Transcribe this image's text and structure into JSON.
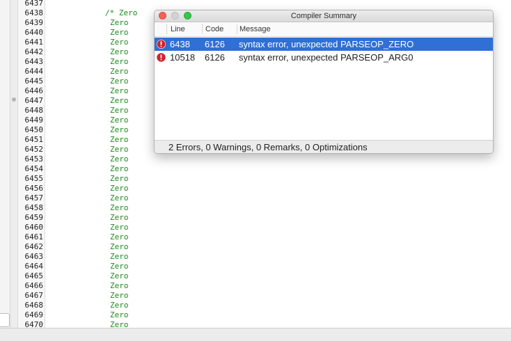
{
  "editor": {
    "lines": [
      {
        "num": "6437",
        "code": ""
      },
      {
        "num": "6438",
        "code": "/* Zero"
      },
      {
        "num": "6439",
        "code": "Zero"
      },
      {
        "num": "6440",
        "code": "Zero"
      },
      {
        "num": "6441",
        "code": "Zero"
      },
      {
        "num": "6442",
        "code": "Zero"
      },
      {
        "num": "6443",
        "code": "Zero"
      },
      {
        "num": "6444",
        "code": "Zero"
      },
      {
        "num": "6445",
        "code": "Zero"
      },
      {
        "num": "6446",
        "code": "Zero"
      },
      {
        "num": "6447",
        "code": "Zero"
      },
      {
        "num": "6448",
        "code": "Zero"
      },
      {
        "num": "6449",
        "code": "Zero"
      },
      {
        "num": "6450",
        "code": "Zero"
      },
      {
        "num": "6451",
        "code": "Zero"
      },
      {
        "num": "6452",
        "code": "Zero"
      },
      {
        "num": "6453",
        "code": "Zero"
      },
      {
        "num": "6454",
        "code": "Zero"
      },
      {
        "num": "6455",
        "code": "Zero"
      },
      {
        "num": "6456",
        "code": "Zero"
      },
      {
        "num": "6457",
        "code": "Zero"
      },
      {
        "num": "6458",
        "code": "Zero"
      },
      {
        "num": "6459",
        "code": "Zero"
      },
      {
        "num": "6460",
        "code": "Zero"
      },
      {
        "num": "6461",
        "code": "Zero"
      },
      {
        "num": "6462",
        "code": "Zero"
      },
      {
        "num": "6463",
        "code": "Zero"
      },
      {
        "num": "6464",
        "code": "Zero"
      },
      {
        "num": "6465",
        "code": "Zero"
      },
      {
        "num": "6466",
        "code": "Zero"
      },
      {
        "num": "6467",
        "code": "Zero"
      },
      {
        "num": "6468",
        "code": "Zero"
      },
      {
        "num": "6469",
        "code": "Zero"
      },
      {
        "num": "6470",
        "code": "Zero"
      }
    ]
  },
  "dialog": {
    "title": "Compiler Summary",
    "columns": {
      "line": "Line",
      "code": "Code",
      "message": "Message"
    },
    "rows": [
      {
        "line": "6438",
        "code": "6126",
        "message": "syntax error, unexpected PARSEOP_ZERO",
        "icon": "error-icon",
        "selected": true
      },
      {
        "line": "10518",
        "code": "6126",
        "message": "syntax error, unexpected PARSEOP_ARG0",
        "icon": "error-icon",
        "selected": false
      }
    ],
    "summary": "2 Errors, 0 Warnings, 0 Remarks, 0 Optimizations"
  },
  "colors": {
    "selection": "#2f6fd6",
    "code_text": "#1a8a1a",
    "error_icon": "#d0222a"
  }
}
